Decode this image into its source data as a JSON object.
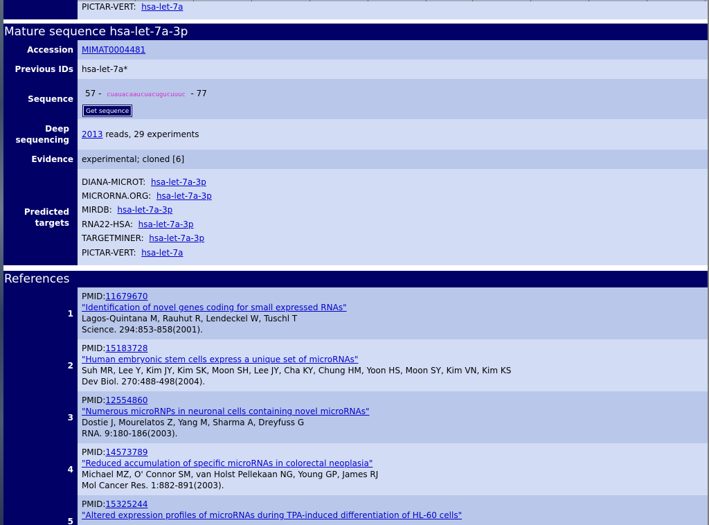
{
  "top": {
    "label": "PICTAR-VERT:",
    "link": "hsa-let-7a"
  },
  "mature": {
    "title": "Mature sequence hsa-let-7a-3p",
    "rows": {
      "accession": {
        "label": "Accession",
        "link": "MIMAT0004481"
      },
      "previous_ids": {
        "label": "Previous IDs",
        "value": "hsa-let-7a*"
      },
      "sequence": {
        "label": "Sequence",
        "start": "57 -",
        "seq": "cuauacaaucuacugucuuuc",
        "end": "- 77",
        "button": "Get sequence"
      },
      "deep": {
        "label_line1": "Deep",
        "label_line2": "sequencing",
        "link": "2013",
        "text": "reads, 29 experiments"
      },
      "evidence": {
        "label": "Evidence",
        "value": "experimental; cloned [6]"
      },
      "predicted": {
        "label_line1": "Predicted",
        "label_line2": "targets",
        "items": [
          {
            "name": "DIANA-MICROT:",
            "link": "hsa-let-7a-3p"
          },
          {
            "name": "MICRORNA.ORG:",
            "link": "hsa-let-7a-3p"
          },
          {
            "name": "MIRDB:",
            "link": "hsa-let-7a-3p"
          },
          {
            "name": "RNA22-HSA:",
            "link": "hsa-let-7a-3p"
          },
          {
            "name": "TARGETMINER:",
            "link": "hsa-let-7a-3p"
          },
          {
            "name": "PICTAR-VERT:",
            "link": "hsa-let-7a"
          }
        ]
      }
    }
  },
  "references": {
    "title": "References",
    "items": [
      {
        "num": "1",
        "pmid_label": "PMID:",
        "pmid": "11679670",
        "title": "\"Identification of novel genes coding for small expressed RNAs\"",
        "authors": "Lagos-Quintana M, Rauhut R, Lendeckel W, Tuschl T",
        "journal": "Science. 294:853-858(2001)."
      },
      {
        "num": "2",
        "pmid_label": "PMID:",
        "pmid": "15183728",
        "title": "\"Human embryonic stem cells express a unique set of microRNAs\"",
        "authors": "Suh MR, Lee Y, Kim JY, Kim SK, Moon SH, Lee JY, Cha KY, Chung HM, Yoon HS, Moon SY, Kim VN, Kim KS",
        "journal": "Dev Biol. 270:488-498(2004)."
      },
      {
        "num": "3",
        "pmid_label": "PMID:",
        "pmid": "12554860",
        "title": "\"Numerous microRNPs in neuronal cells containing novel microRNAs\"",
        "authors": "Dostie J, Mourelatos Z, Yang M, Sharma A, Dreyfuss G",
        "journal": "RNA. 9:180-186(2003)."
      },
      {
        "num": "4",
        "pmid_label": "PMID:",
        "pmid": "14573789",
        "title": "\"Reduced accumulation of specific microRNAs in colorectal neoplasia\"",
        "authors": "Michael MZ, O' Connor SM, van Holst Pellekaan NG, Young GP, James RJ",
        "journal": "Mol Cancer Res. 1:882-891(2003)."
      },
      {
        "num": "5",
        "pmid_label": "PMID:",
        "pmid": "15325244",
        "title": "\"Altered expression profiles of microRNAs during TPA-induced differentiation of HL-60 cells\""
      }
    ]
  }
}
